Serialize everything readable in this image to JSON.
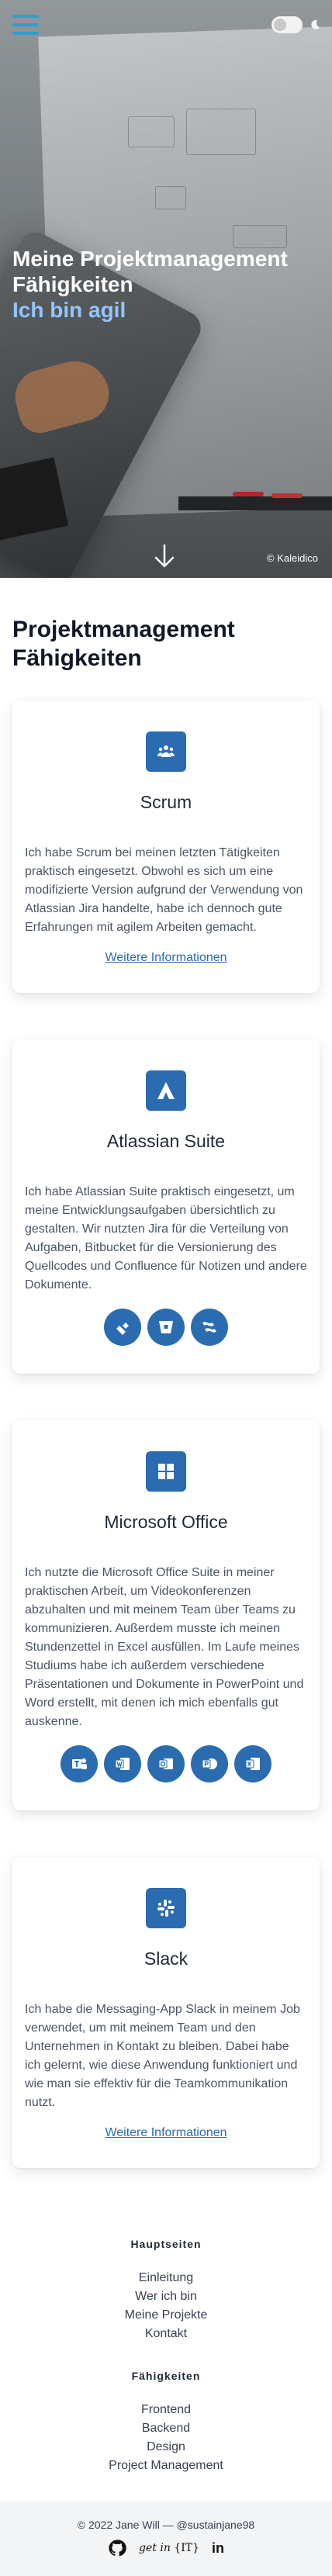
{
  "hero": {
    "title": "Meine Projektmanagement Fähigkeiten",
    "subtitle": "Ich bin agil",
    "image_credit": "© Kaleidico",
    "icons": {
      "menu": "hamburger-menu-icon",
      "theme": "moon-icon",
      "scroll": "arrow-down-icon"
    }
  },
  "skills": {
    "heading": "Projektmanagement Fähigkeiten",
    "cards": [
      {
        "icon": "users-icon",
        "title": "Scrum",
        "text": "Ich habe Scrum bei meinen letzten Tätigkeiten praktisch eingesetzt. Obwohl es sich um eine modifizierte Version aufgrund der Verwendung von Atlassian Jira handelte, habe ich dennoch gute Erfahrungen mit agilem Arbeiten gemacht.",
        "link": "Weitere Informationen"
      },
      {
        "icon": "atlassian-icon",
        "title": "Atlassian Suite",
        "text": "Ich habe Atlassian Suite praktisch eingesetzt, um meine Entwicklungsaufgaben übersichtlich zu gestalten. Wir nutzten Jira für die Verteilung von Aufgaben, Bitbucket für die Versionierung des Quellcodes und Confluence für Notizen und andere Dokumente.",
        "tools": [
          "jira-icon",
          "bitbucket-icon",
          "confluence-icon"
        ]
      },
      {
        "icon": "windows-icon",
        "title": "Microsoft Office",
        "text": "Ich nutzte die Microsoft Office Suite in meiner praktischen Arbeit, um Videokonferenzen abzuhalten und mit meinem Team über Teams zu kommunizieren. Außerdem musste ich meinen Stundenzettel in Excel ausfüllen. Im Laufe meines Studiums habe ich außerdem verschiedene Präsentationen und Dokumente in PowerPoint und Word erstellt, mit denen ich mich ebenfalls gut auskenne.",
        "tools": [
          "teams-icon",
          "word-icon",
          "outlook-icon",
          "powerpoint-icon",
          "excel-icon"
        ]
      },
      {
        "icon": "slack-icon",
        "title": "Slack",
        "text": "Ich habe die Messaging-App Slack in meinem Job verwendet, um mit meinem Team und den Unternehmen in Kontakt zu bleiben. Dabei habe ich gelernt, wie diese Anwendung funktioniert und wie man sie effektiv für die Teamkommunikation nutzt.",
        "link": "Weitere Informationen"
      }
    ]
  },
  "footer": {
    "main_heading": "Hauptseiten",
    "main_links": [
      "Einleitung",
      "Wer ich bin",
      "Meine Projekte",
      "Kontakt"
    ],
    "skills_heading": "Fähigkeiten",
    "skills_links": [
      "Frontend",
      "Backend",
      "Design",
      "Project Management"
    ],
    "copyright": "© 2022 Jane Will — @sustainjane98",
    "social": {
      "github": "github-icon",
      "getin_prefix": "get in",
      "getin_badge": "{IT}",
      "linkedin": "in"
    }
  },
  "colors": {
    "accent": "#2b6cb0",
    "hero_subtitle": "#93c5fd",
    "menu": "#2e9fd1",
    "footer_bg": "#f3f4f6"
  }
}
